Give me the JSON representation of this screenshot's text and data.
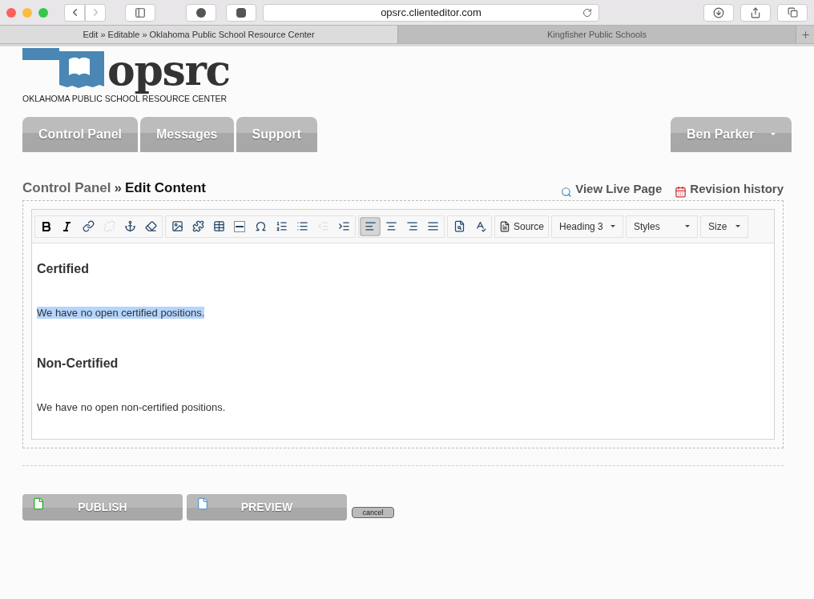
{
  "browser": {
    "url": "opsrc.clienteditor.com",
    "tabs": [
      {
        "title": "Edit » Editable » Oklahoma Public School Resource Center",
        "selected": true
      },
      {
        "title": "Kingfisher Public Schools",
        "selected": false
      }
    ]
  },
  "logo": {
    "wordmark": "opsrc",
    "tagline": "OKLAHOMA PUBLIC SCHOOL RESOURCE CENTER"
  },
  "nav": {
    "tabs": [
      "Control Panel",
      "Messages",
      "Support"
    ],
    "user": "Ben Parker"
  },
  "breadcrumb": {
    "parent": "Control Panel",
    "separator": "»",
    "current": "Edit Content"
  },
  "page_links": [
    "View Live Page",
    "Revision history"
  ],
  "toolbar": {
    "groups": [
      [
        {
          "disabled": false,
          "selected": false
        },
        {
          "disabled": false,
          "selected": false
        },
        {
          "disabled": false,
          "selected": false
        },
        {
          "disabled": true,
          "selected": false
        },
        {
          "disabled": false,
          "selected": false
        },
        {
          "disabled": false,
          "selected": false
        }
      ],
      [
        {
          "disabled": false,
          "selected": false
        },
        {
          "disabled": false,
          "selected": false
        },
        {
          "disabled": false,
          "selected": false
        },
        {
          "disabled": false,
          "selected": false
        },
        {
          "disabled": false,
          "selected": false
        },
        {
          "disabled": false,
          "selected": false
        },
        {
          "disabled": false,
          "selected": false
        },
        {
          "disabled": true,
          "selected": false
        },
        {
          "disabled": false,
          "selected": false
        }
      ],
      [
        {
          "disabled": false,
          "selected": true
        },
        {
          "disabled": false,
          "selected": false
        },
        {
          "disabled": false,
          "selected": false
        },
        {
          "disabled": false,
          "selected": false
        }
      ],
      [
        {
          "disabled": false,
          "selected": false
        },
        {
          "disabled": false,
          "selected": false
        }
      ]
    ],
    "source": "Source",
    "dropdowns": [
      "Heading 3",
      "Styles",
      "Size"
    ]
  },
  "content": [
    {
      "kind": "heading",
      "text": "Certified",
      "selected": false
    },
    {
      "kind": "paragraph",
      "text": "We have no open certified positions.",
      "selected": true
    },
    {
      "kind": "heading",
      "text": "Non-Certified",
      "selected": false
    },
    {
      "kind": "paragraph",
      "text": "We have no open non-certified positions.",
      "selected": false
    }
  ],
  "actions": {
    "publish": "PUBLISH",
    "preview": "PREVIEW",
    "cancel": "cancel"
  }
}
